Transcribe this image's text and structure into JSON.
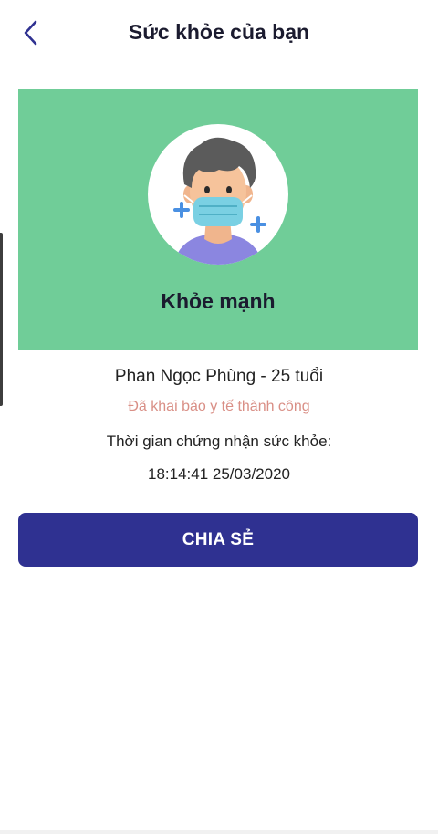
{
  "header": {
    "title": "Sức khỏe của bạn",
    "back_icon": "chevron-left-icon"
  },
  "status_card": {
    "status": "Khỏe mạnh",
    "background_color": "#70cd98",
    "avatar_icon": "masked-person-icon"
  },
  "user": {
    "name_age": "Phan Ngọc Phùng - 25 tuổi",
    "declaration_status": "Đã khai báo y tế thành công",
    "certification_label": "Thời gian chứng nhận sức khỏe:",
    "certification_time": "18:14:41 25/03/2020"
  },
  "actions": {
    "share_label": "CHIA SẺ",
    "share_color": "#2f3191"
  },
  "colors": {
    "accent": "#2f3191",
    "healthy_green": "#70cd98",
    "status_text": "#d98f86"
  }
}
